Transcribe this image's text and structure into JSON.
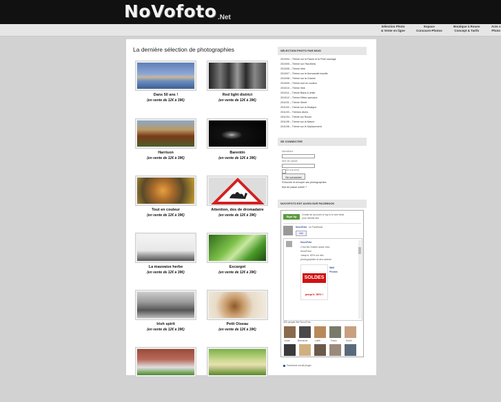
{
  "header": {
    "logo": "NoVofoto",
    "logo_suffix": ".Net",
    "nav": [
      {
        "line1": "Sélection Photo",
        "line2": "& Vente en ligne"
      },
      {
        "line1": "Espace",
        "line2": "Concours-Photos"
      },
      {
        "line1": "Boutique à Rouen",
        "line2": "Concept & Tarifs"
      },
      {
        "line1": "Acts s",
        "line2": "Photo"
      }
    ]
  },
  "main": {
    "heading": "La dernière sélection de photographies",
    "cards": [
      {
        "title": "Dans 50 ans !",
        "price": "(en vente de 12€ à 39€)"
      },
      {
        "title": "Red light district",
        "price": "(en vente de 12€ à 39€)"
      },
      {
        "title": "Harrison",
        "price": "(en vente de 12€ à 39€)"
      },
      {
        "title": "Barentin",
        "price": "(en vente de 12€ à 39€)"
      },
      {
        "title": "Tout en couleur",
        "price": "(en vente de 12€ à 39€)"
      },
      {
        "title": "Attention, dos de dromadaire",
        "price": "(en vente de 12€ à 39€)"
      },
      {
        "title": "La mauvaise herbe",
        "price": "(en vente de 12€ à 39€)"
      },
      {
        "title": "Escargot",
        "price": "(en vente de 12€ à 39€)"
      },
      {
        "title": "Irish spirit",
        "price": "(en vente de 12€ à 39€)"
      },
      {
        "title": "Petit Oiseau",
        "price": "(en vente de 12€ à 39€)"
      },
      {
        "title": "",
        "price": ""
      },
      {
        "title": "",
        "price": ""
      }
    ]
  },
  "sidebar": {
    "month_heading": "SÉLECTION PHOTO PAR MOIS",
    "months": [
      "2010/04 – Thème sur la Faune et la Flore sauvage",
      "2010/05 – Thème sur l'Nocthéla",
      "2010/06 – Thème libre",
      "2010/07 – Thème sur la Normandie insolite",
      "2010/08 – Thème sur la Cuisine",
      "2010/09 – Thème tout en couleur",
      "2010/10 – Thème libre",
      "2010/11 – Thème Black & white",
      "2010/12 – Thème Effets spéciaux",
      "2011/01 – Thème Street",
      "2011/02 – Thème sur la Musique",
      "2011/03 – Thèmes divers",
      "2011/04 – Thème sur Rouen",
      "2011/05 – Thème sur la Nature",
      "2011/06 – Thème sur le Déplacement"
    ],
    "login_heading": "SE CONNECTER",
    "login": {
      "id_label": "Identifiant",
      "pass_label": "Mot de passe",
      "remember": "Se souvenir",
      "button": "Se connecter",
      "link1": "S'inscrire et envoyer ses photographies",
      "link2": "Mot de passe oublié ?"
    },
    "fb_heading": "NOVOFOTO EST AUSSI SUR FACEBOOK",
    "fb": {
      "signup": "Sign Up",
      "signup_text1": "Create an account or log in to see what",
      "signup_text2": "your friends like.",
      "page_name": "NovoFoto",
      "on_facebook": "on Facebook",
      "like": "Like",
      "post_author": "NovoFoto",
      "post_line1": "C'est les Soldes aussi chez",
      "post_line2": "NovoFoto!",
      "post_line3": "Jusqu'à -50% sur des",
      "post_line4": "photographies et des cadres!",
      "soldes": "SOLDES",
      "soldes_sub": "jusqu'à -50% !",
      "wall": "Wall",
      "photos": "Photos",
      "people_like": "453 people like NovoFoto",
      "friends": [
        "Jonat",
        "Brenarde",
        "Laëti",
        "Franc",
        "Sordi"
      ],
      "plugin": "Facebook social plugin"
    }
  }
}
